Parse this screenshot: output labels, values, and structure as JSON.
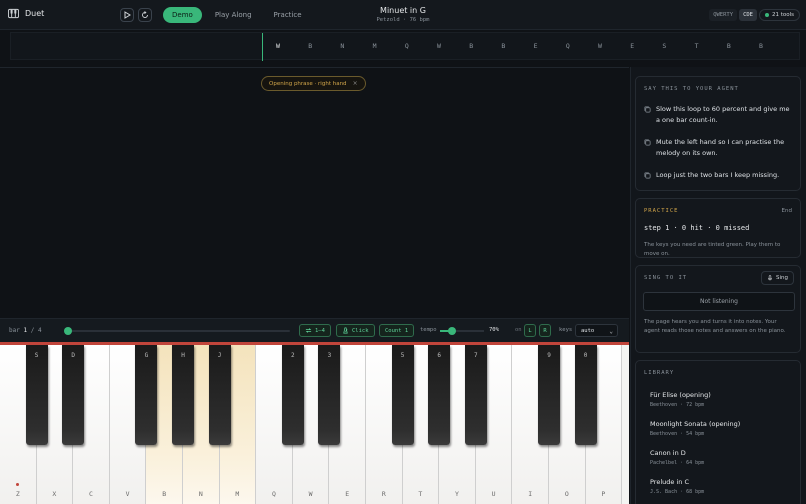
{
  "app": {
    "name": "Duet"
  },
  "modes": [
    "Demo",
    "Play Along",
    "Practice"
  ],
  "active_mode": "Demo",
  "song": {
    "title": "Minuet in G",
    "subtitle": "Petzold · 76 bpm"
  },
  "keyboard_layouts": [
    "QWERTY",
    "CDE"
  ],
  "active_layout": "CDE",
  "tools": {
    "label": "21 tools"
  },
  "note_stream": [
    "W",
    "B",
    "N",
    "M",
    "Q",
    "W",
    "B",
    "B",
    "E",
    "Q",
    "W",
    "E",
    "S",
    "T",
    "B",
    "B"
  ],
  "phrase": {
    "label": "Opening phrase · right hand",
    "close": "×"
  },
  "transport": {
    "bar_prefix": "bar",
    "bar_current": "1",
    "bar_total": "/ 4",
    "progress": 0,
    "loop_label": "1–4",
    "click_label": "Click",
    "count_label": "Count 1",
    "tempo_label": "tempo",
    "tempo_percent": 70,
    "tempo_value": "70%",
    "on_label": "on",
    "hands": [
      "L",
      "R"
    ],
    "keys_label": "keys",
    "keys_value": "auto"
  },
  "piano": {
    "white_keys": [
      "Z",
      "X",
      "C",
      "V",
      "B",
      "N",
      "M",
      "Q",
      "W",
      "E",
      "R",
      "T",
      "Y",
      "U",
      "I",
      "O",
      "P"
    ],
    "highlighted_white": [
      4,
      5,
      6
    ],
    "black_keys": [
      {
        "label": "S",
        "after": 0
      },
      {
        "label": "D",
        "after": 1
      },
      {
        "label": "G",
        "after": 3
      },
      {
        "label": "H",
        "after": 4
      },
      {
        "label": "J",
        "after": 5
      },
      {
        "label": "2",
        "after": 7
      },
      {
        "label": "3",
        "after": 8
      },
      {
        "label": "5",
        "after": 10
      },
      {
        "label": "6",
        "after": 11
      },
      {
        "label": "7",
        "after": 12
      },
      {
        "label": "9",
        "after": 14
      },
      {
        "label": "0",
        "after": 15
      }
    ]
  },
  "agent": {
    "heading": "SAY THIS TO YOUR AGENT",
    "suggestions": [
      "Slow this loop to 60 percent and give me a one bar count-in.",
      "Mute the left hand so I can practise the melody on its own.",
      "Loop just the two bars I keep missing."
    ]
  },
  "practice": {
    "heading": "PRACTICE",
    "end_label": "End",
    "status": "step 1 · 0 hit · 0 missed",
    "hint": "The keys you need are tinted green. Play them to move on."
  },
  "sing": {
    "heading": "SING TO IT",
    "button": "Sing",
    "status": "Not listening",
    "description": "The page hears you and turns it into notes. Your agent reads those notes and answers on the piano."
  },
  "library": {
    "heading": "LIBRARY",
    "items": [
      {
        "title": "Für Elise (opening)",
        "sub": "Beethoven · 72 bpm"
      },
      {
        "title": "Moonlight Sonata (opening)",
        "sub": "Beethoven · 54 bpm"
      },
      {
        "title": "Canon in D",
        "sub": "Pachelbel · 64 bpm"
      },
      {
        "title": "Prelude in C",
        "sub": "J.S. Bach · 68 bpm"
      }
    ]
  },
  "colors": {
    "accent": "#39b77a",
    "warm": "#d2a64a",
    "piano_rail": "#c1453b"
  }
}
